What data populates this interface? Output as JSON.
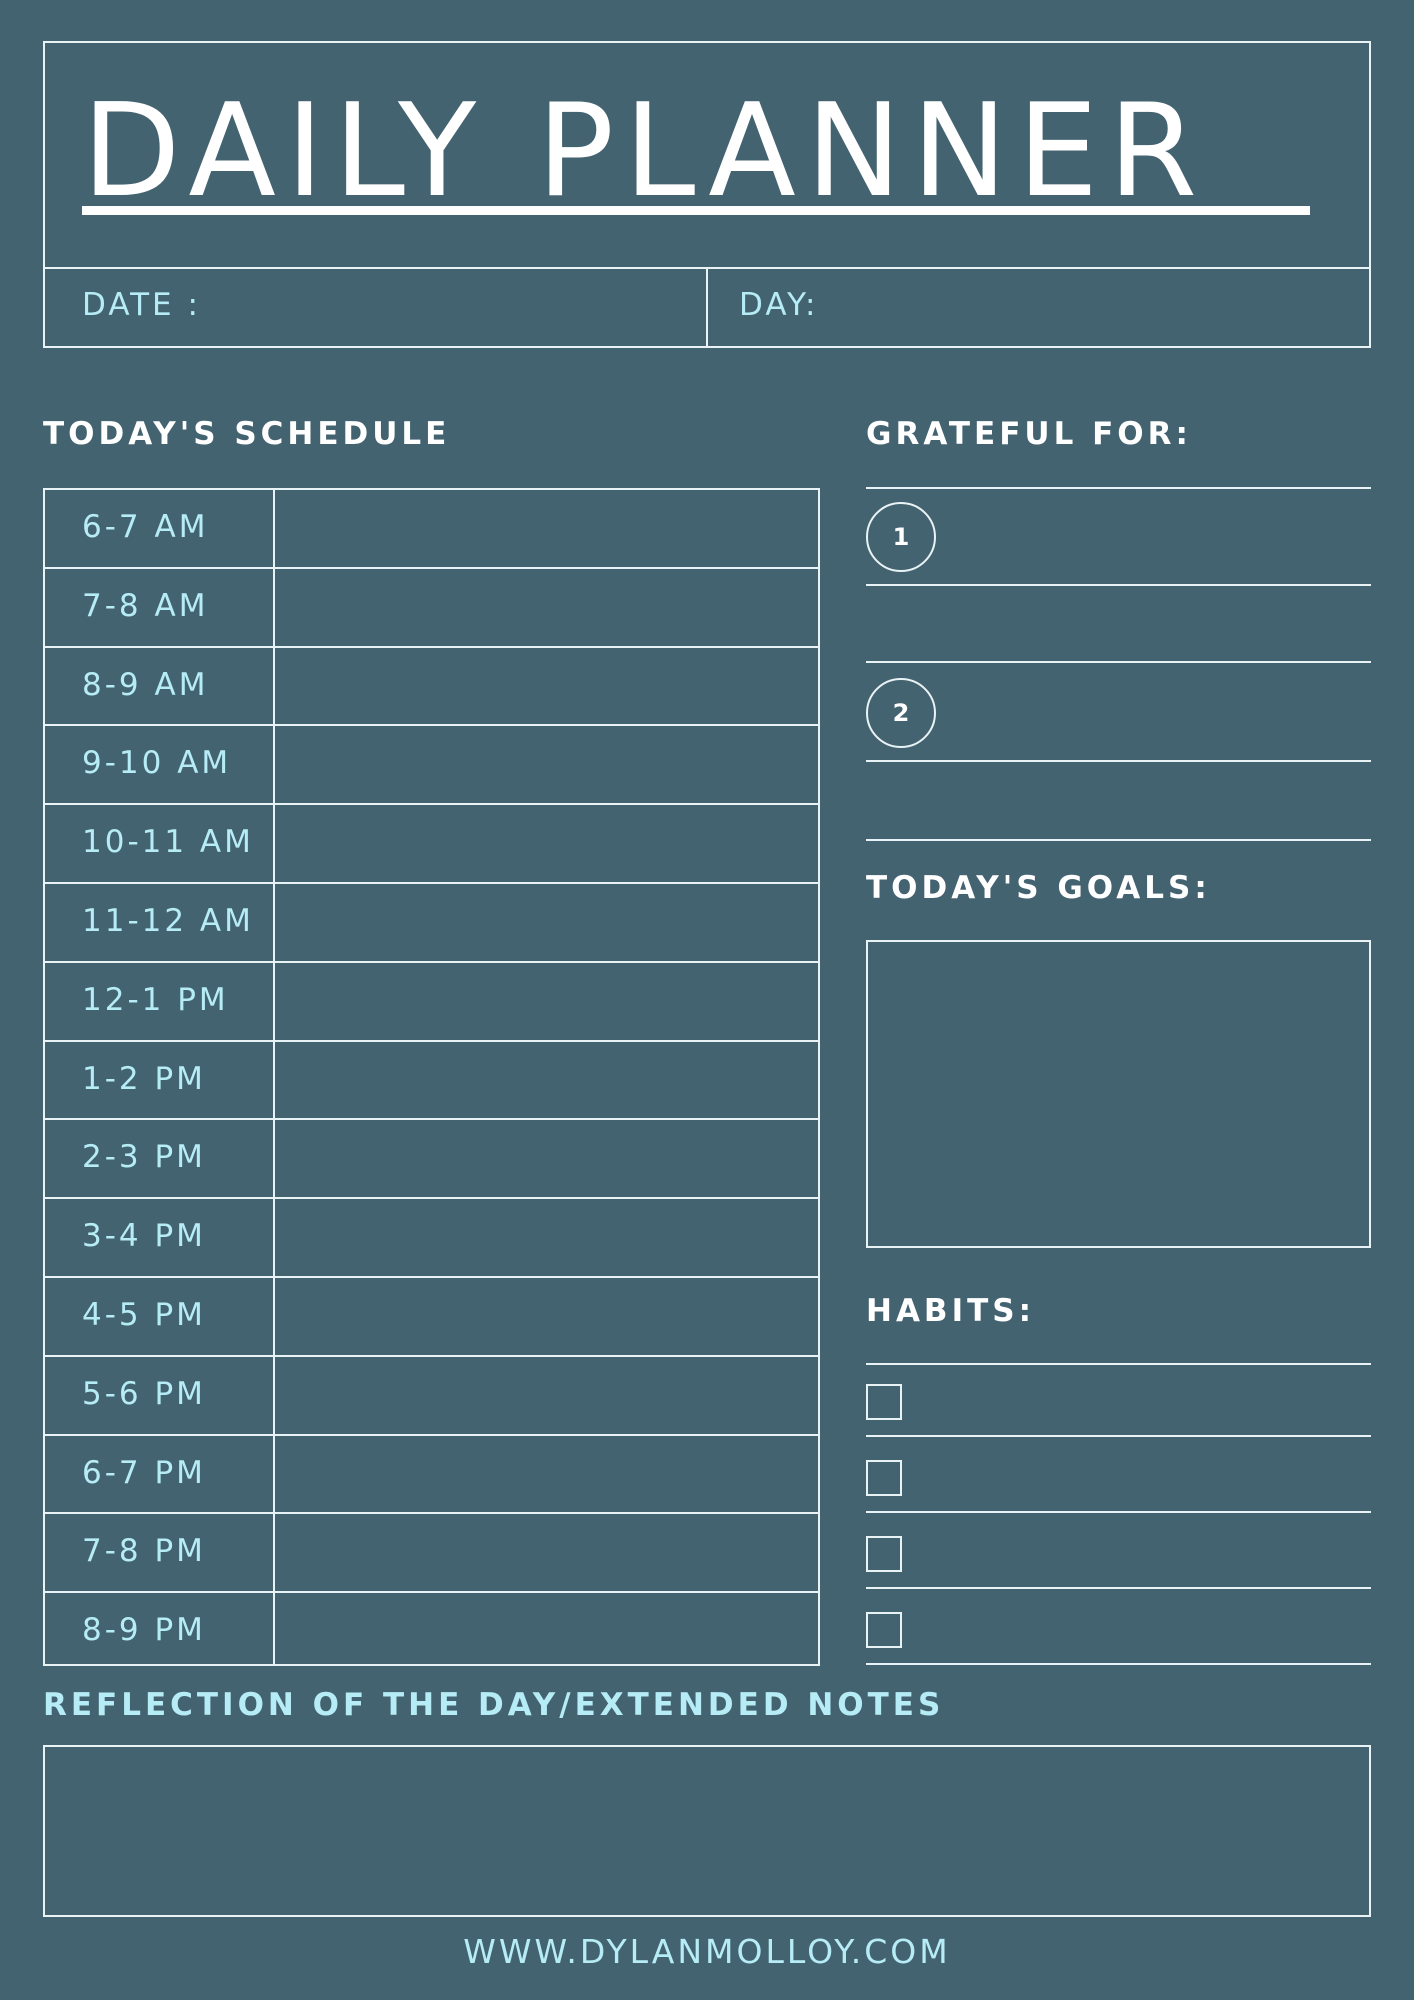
{
  "title": "DAILY PLANNER",
  "date_label": "DATE :",
  "day_label": "DAY:",
  "schedule": {
    "heading": "TODAY'S SCHEDULE",
    "slots": [
      "6-7 AM",
      "7-8 AM",
      "8-9 AM",
      "9-10 AM",
      "10-11 AM",
      "11-12 AM",
      "12-1 PM",
      "1-2 PM",
      "2-3 PM",
      "3-4 PM",
      "4-5 PM",
      "5-6 PM",
      "6-7 PM",
      "7-8 PM",
      "8-9 PM"
    ]
  },
  "grateful": {
    "heading": "GRATEFUL FOR:",
    "items": [
      "1",
      "2"
    ]
  },
  "goals": {
    "heading": "TODAY'S GOALS:"
  },
  "habits": {
    "heading": "HABITS:"
  },
  "reflection": {
    "heading": "REFLECTION OF THE DAY/EXTENDED NOTES"
  },
  "footer": {
    "url": "WWW.DYLANMOLLOY.COM"
  },
  "colors": {
    "background": "#446371",
    "line": "#e9f3f5",
    "accent_text": "#b6ecf5",
    "heading_text": "#ffffff"
  }
}
